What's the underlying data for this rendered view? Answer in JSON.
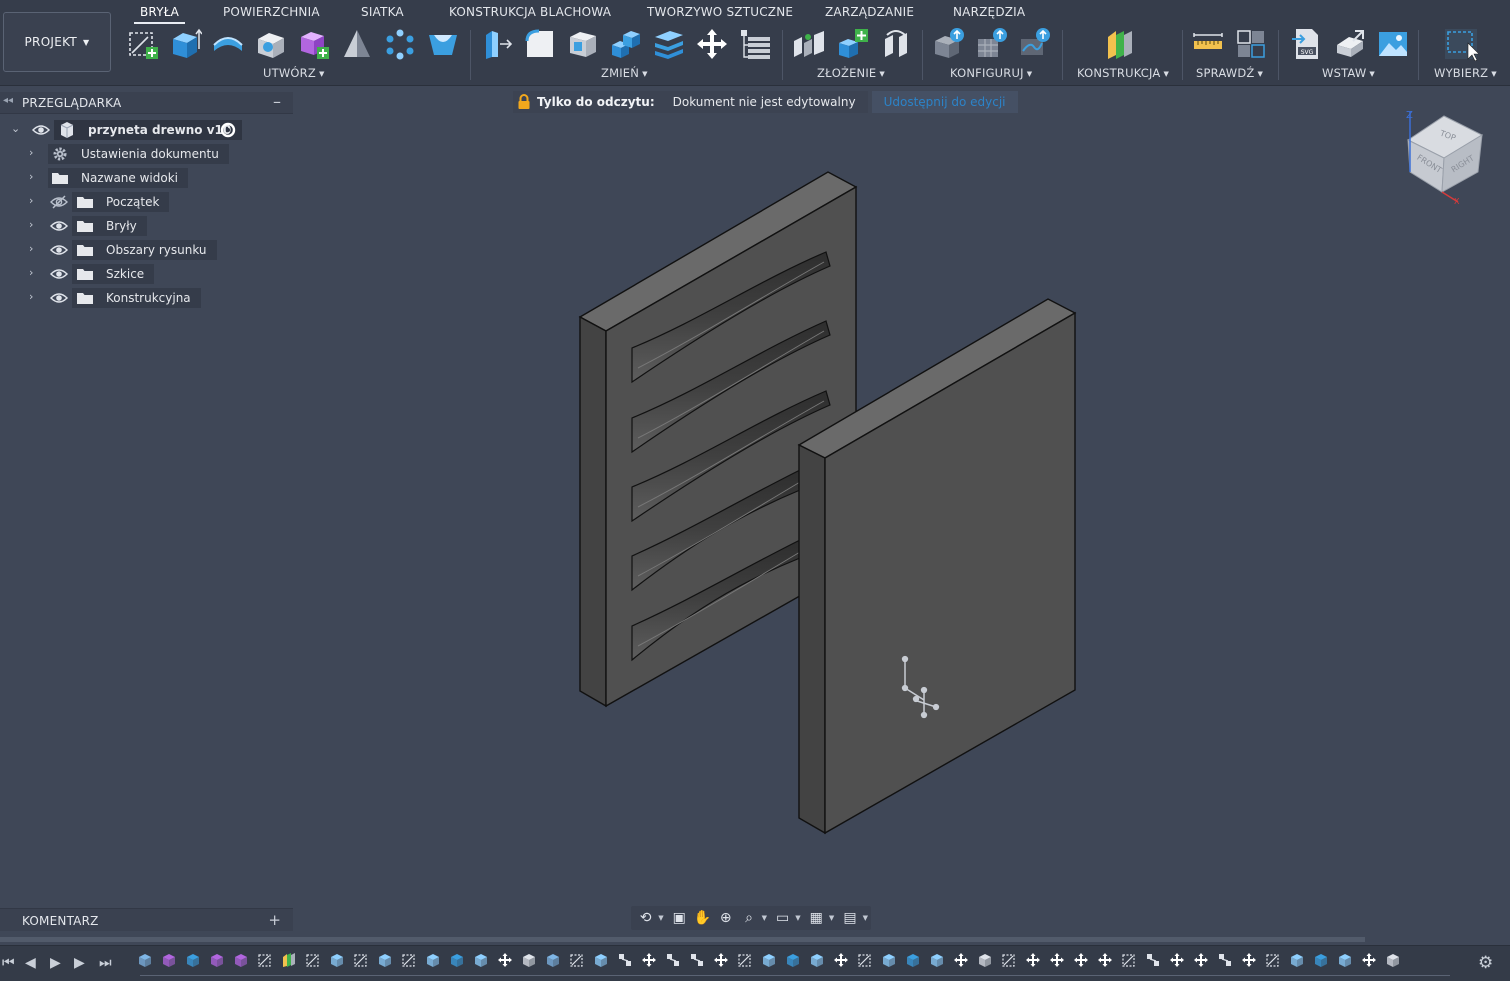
{
  "app": {
    "project_button": "PROJEKT",
    "tabs": [
      {
        "label": "BRYŁA",
        "active": true
      },
      {
        "label": "POWIERZCHNIA",
        "active": false
      },
      {
        "label": "SIATKA",
        "active": false
      },
      {
        "label": "KONSTRUKCJA BLACHOWA",
        "active": false
      },
      {
        "label": "TWORZYWO SZTUCZNE",
        "active": false
      },
      {
        "label": "ZARZĄDZANIE",
        "active": false
      },
      {
        "label": "NARZĘDZIA",
        "active": false
      }
    ],
    "groups": [
      {
        "label": "UTWÓRZ"
      },
      {
        "label": "ZMIEŃ"
      },
      {
        "label": "ZŁOŻENIE"
      },
      {
        "label": "KONFIGURUJ"
      },
      {
        "label": "KONSTRUKCJA"
      },
      {
        "label": "SPRAWDŹ"
      },
      {
        "label": "WSTAW"
      },
      {
        "label": "WYBIERZ"
      }
    ],
    "accent_color": "#3b9fe0"
  },
  "browser": {
    "title": "PRZEGLĄDARKA",
    "root": "przyneta drewno v10",
    "items": [
      {
        "label": "Ustawienia dokumentu",
        "icon": "gear-icon"
      },
      {
        "label": "Nazwane widoki",
        "icon": "folder-icon"
      },
      {
        "label": "Początek",
        "icon": "folder-icon",
        "visibility": "hidden"
      },
      {
        "label": "Bryły",
        "icon": "folder-icon",
        "visibility": "visible"
      },
      {
        "label": "Obszary rysunku",
        "icon": "folder-icon",
        "visibility": "visible"
      },
      {
        "label": "Szkice",
        "icon": "folder-icon",
        "visibility": "visible"
      },
      {
        "label": "Konstrukcyjna",
        "icon": "folder-icon",
        "visibility": "visible"
      }
    ]
  },
  "banner": {
    "label": "Tylko do odczytu:",
    "message": "Dokument nie jest edytowalny",
    "share_link": "Udostępnij do edycji"
  },
  "viewcube": {
    "top": "TOP",
    "front": "FRONT",
    "right": "RIGHT",
    "axis_z": "Z",
    "axis_x": "X"
  },
  "comments": {
    "title": "KOMENTARZ"
  }
}
